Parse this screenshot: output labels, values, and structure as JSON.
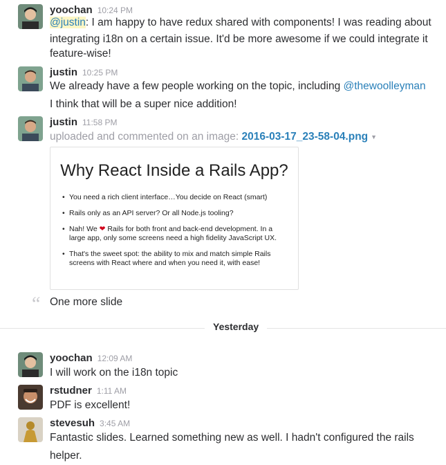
{
  "messages": [
    {
      "user": "yoochan",
      "time": "10:24 PM",
      "mention": "@justin",
      "line1_rest": ": I am happy to have redux shared with components! I was reading about",
      "line2": "integrating i18n on a certain issue. It'd be more awesome if we could integrate it",
      "line3": "feature-wise!"
    },
    {
      "user": "justin",
      "time": "10:25 PM",
      "line1_prefix": "We already have a few people working on the topic, including ",
      "line1_link": "@thewoolleyman",
      "line2": "I think that will be a super nice addition!"
    },
    {
      "user": "justin",
      "time": "11:58 PM",
      "upload_text": "uploaded and commented on an image: ",
      "file_name": "2016-03-17_23-58-04.png",
      "comment": "One more slide"
    }
  ],
  "slide": {
    "title": "Why React Inside a Rails App?",
    "bullets": [
      "You need a rich client interface…You decide on React (smart)",
      "Rails only as an API server? Or all Node.js tooling?",
      "Nah! We",
      "Rails for both front and back-end development. In a large app, only some screens need a high fidelity JavaScript UX.",
      "That's the sweet spot: the ability to mix and match simple Rails screens with React where and when you need it, with ease!"
    ]
  },
  "day_divider": "Yesterday",
  "later_messages": [
    {
      "user": "yoochan",
      "time": "12:09 AM",
      "text": "I will work on the i18n topic"
    },
    {
      "user": "rstudner",
      "time": "1:11 AM",
      "text": "PDF is excellent!"
    },
    {
      "user": "stevesuh",
      "time": "3:45 AM",
      "text": "Fantastic slides.  Learned something new as well.  I hadn't configured the rails helper."
    }
  ],
  "colors": {
    "link": "#2a80b9",
    "mention_bg": "#fdf6c5",
    "muted": "#9e9ea6",
    "heart": "#d0021b"
  }
}
